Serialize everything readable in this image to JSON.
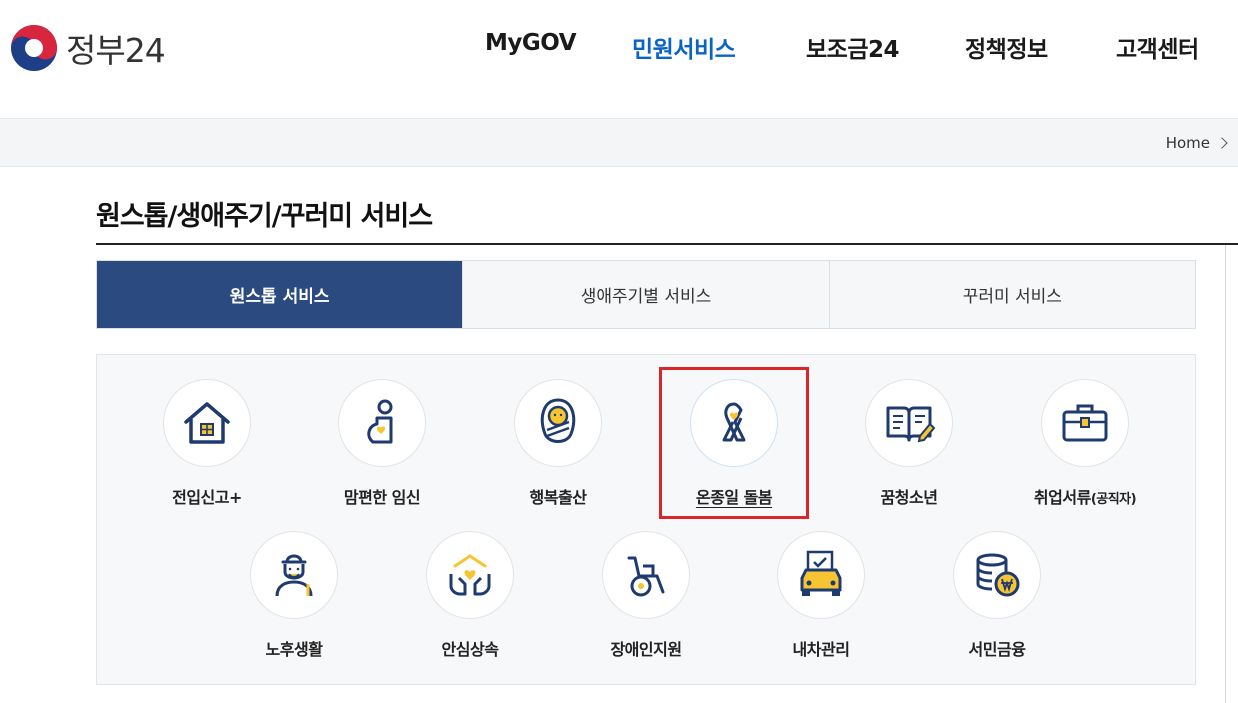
{
  "header": {
    "logo_text": "정부24",
    "nav": [
      "MyGOV",
      "민원서비스",
      "보조금24",
      "정책정보",
      "고객센터"
    ],
    "active_nav": "민원서비스"
  },
  "breadcrumb": {
    "home": "Home"
  },
  "page_title": "원스톱/생애주기/꾸러미 서비스",
  "tabs": [
    "원스톱 서비스",
    "생애주기별 서비스",
    "꾸러미 서비스"
  ],
  "active_tab": "원스톱 서비스",
  "services": [
    {
      "label": "전입신고+",
      "icon": "house-icon"
    },
    {
      "label": "맘편한 임신",
      "icon": "pregnancy-icon"
    },
    {
      "label": "행복출산",
      "icon": "baby-icon"
    },
    {
      "label": "온종일 돌봄",
      "icon": "ribbon-icon",
      "selected": true
    },
    {
      "label": "꿈청소년",
      "icon": "book-icon"
    },
    {
      "label": "취업서류",
      "label_sub": "(공직자)",
      "icon": "briefcase-icon"
    },
    {
      "label": "노후생활",
      "icon": "elder-icon"
    },
    {
      "label": "안심상속",
      "icon": "hands-heart-icon"
    },
    {
      "label": "장애인지원",
      "icon": "wheelchair-icon"
    },
    {
      "label": "내차관리",
      "icon": "car-icon"
    },
    {
      "label": "서민금융",
      "icon": "coins-icon"
    }
  ],
  "colors": {
    "brand_blue": "#0b63c5",
    "tab_active": "#2a4a80",
    "icon_navy": "#1e3a6e",
    "icon_yellow": "#f7c531",
    "highlight_red": "#d9262b"
  }
}
